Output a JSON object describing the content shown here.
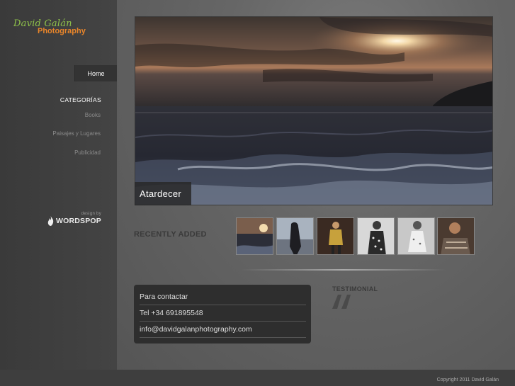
{
  "logo": {
    "line1": "David Galán",
    "line2": "Photography",
    "green": "#8fc24a",
    "orange": "#e8852a"
  },
  "nav": {
    "home": "Home"
  },
  "categories": {
    "heading": "CATEGORÍAS",
    "items": [
      "Books",
      "Paisajes y Lugares",
      "Publicidad"
    ]
  },
  "credit": {
    "small": "design by",
    "brand": "WORDSPOP"
  },
  "hero": {
    "caption": "Atardecer"
  },
  "recent": {
    "label": "RECENTLY ADDED",
    "thumbs": [
      "sunset-sea-thumb",
      "woman-dark-coat-thumb",
      "woman-gold-dress-thumb",
      "woman-polka-dress-thumb",
      "woman-white-dress-thumb",
      "woman-patterned-top-thumb"
    ]
  },
  "contact": {
    "title": "Para contactar",
    "phone": "Tel +34 691895548",
    "email": "info@davidgalanphotography.com"
  },
  "testimonial": {
    "label": "TESTIMONIAL"
  },
  "footer": {
    "copyright": "Copyright 2011 David Galán"
  }
}
